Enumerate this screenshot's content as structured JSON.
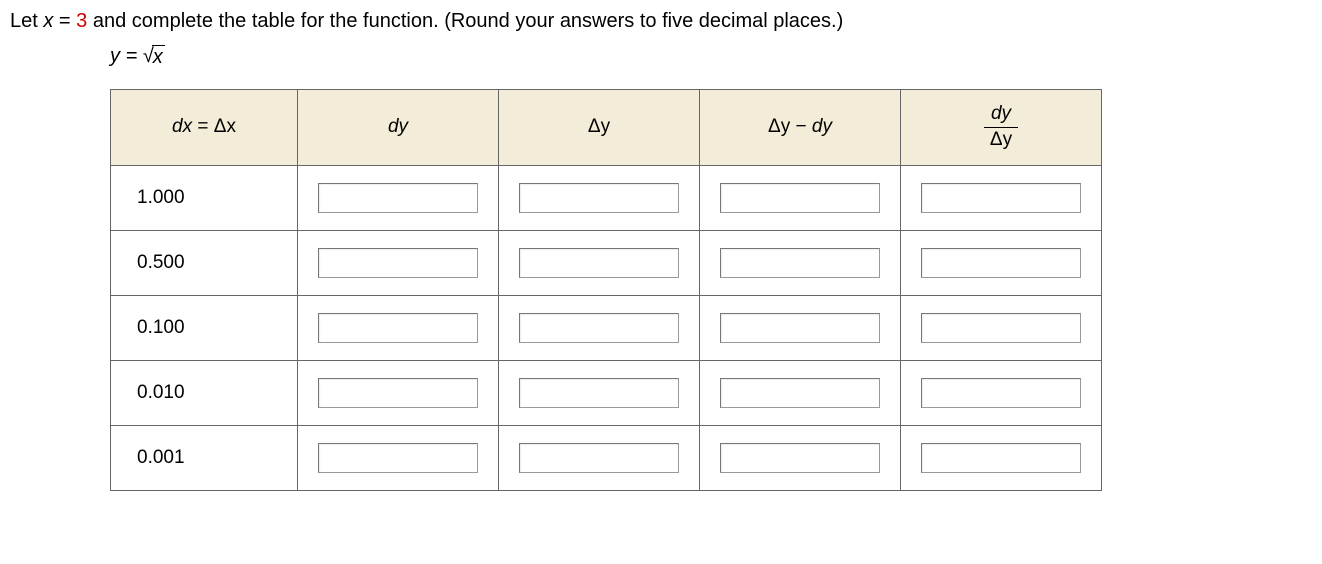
{
  "problem": {
    "prefix": "Let ",
    "varname": "x",
    "equals": " = ",
    "xvalue": "3",
    "suffix": " and complete the table for the function. (Round your answers to five decimal places.)"
  },
  "function": {
    "yvar": "y",
    "eq": " = ",
    "radicand": "x"
  },
  "headers": {
    "col1_dx": "dx",
    "col1_eq": " = ",
    "col1_deltax": "Δx",
    "col2": "dy",
    "col3": "Δy",
    "col4_deltay": "Δy",
    "col4_minus": " − ",
    "col4_dy": "dy",
    "col5_num": "dy",
    "col5_den": "Δy"
  },
  "rows": [
    {
      "dx": "1.000"
    },
    {
      "dx": "0.500"
    },
    {
      "dx": "0.100"
    },
    {
      "dx": "0.010"
    },
    {
      "dx": "0.001"
    }
  ]
}
